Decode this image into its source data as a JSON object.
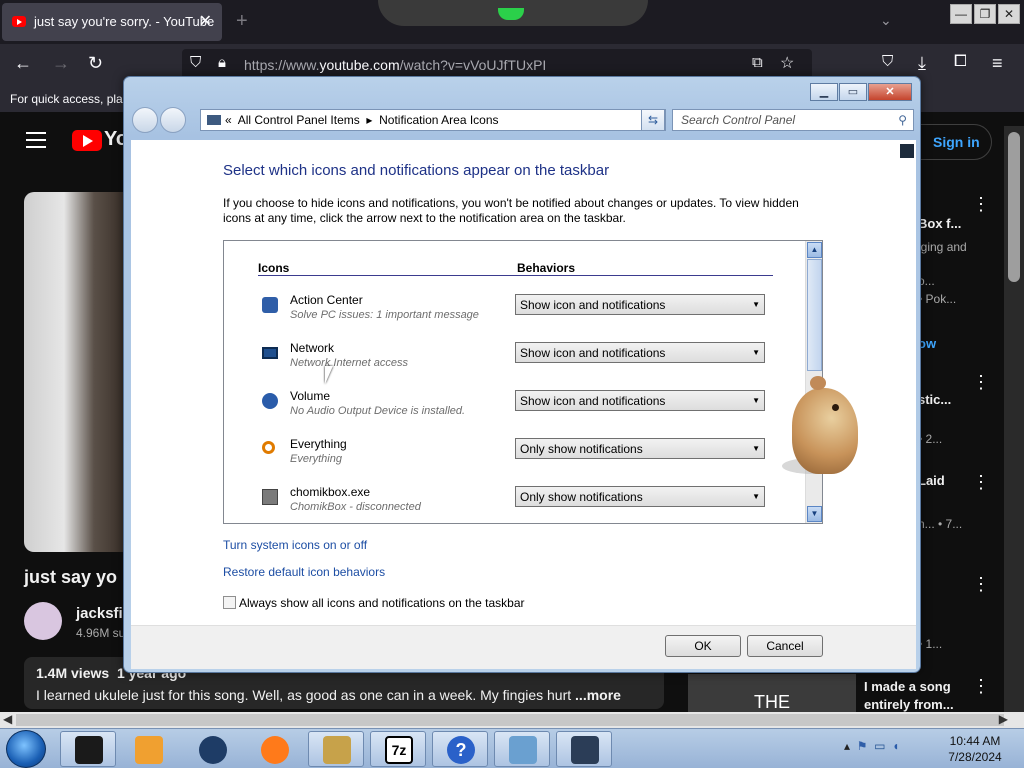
{
  "browser": {
    "tab_title": "just say you're sorry. - YouTube",
    "tab_close": "✕",
    "new_tab": "+",
    "url_prefix": "https://www.",
    "url_domain": "youtube.com",
    "url_rest": "/watch?v=vVoUJfTUxPI",
    "bookmarks_text": "For quick access, plac",
    "window_buttons": [
      "—",
      "❐",
      "✕"
    ]
  },
  "youtube": {
    "logo_text": "Yo",
    "sign_in": "Sign in",
    "video_title": "just say yo",
    "channel_name": "jacksfi",
    "channel_subs": "4.96M su",
    "views": "1.4M views",
    "age": "1 year ago",
    "description": "I learned ukulele just for this song. Well, as good as one can in a week. My fingies hurt",
    "more": "...more",
    "side": [
      {
        "title": "Box f...",
        "sub": "iging and"
      },
      {
        "title": "",
        "sub": "o..."
      },
      {
        "title": "",
        "sub": "• Pok..."
      },
      {
        "title": "ow",
        "sub": ""
      },
      {
        "title": "stic...",
        "sub": "• 2..."
      },
      {
        "title": "Laid",
        "sub": "n... • 7..."
      },
      {
        "title": "",
        "sub": "• 1..."
      }
    ],
    "bottom_thumb_text": "THE",
    "bottom_title_1": "I made a song",
    "bottom_title_2": "entirely from..."
  },
  "control_panel": {
    "breadcrumb_root": "All Control Panel Items",
    "breadcrumb_current": "Notification Area Icons",
    "search_placeholder": "Search Control Panel",
    "heading": "Select which icons and notifications appear on the taskbar",
    "intro": "If you choose to hide icons and notifications, you won't be notified about changes or updates. To view hidden icons at any time, click the arrow next to the notification area on the taskbar.",
    "col_icons": "Icons",
    "col_behaviors": "Behaviors",
    "rows": [
      {
        "name": "Action Center",
        "sub": "Solve PC issues: 1 important message",
        "behavior": "Show icon and notifications",
        "icon": "flag-icon",
        "color": "#2f5ea8"
      },
      {
        "name": "Network",
        "sub": "Network Internet access",
        "behavior": "Show icon and notifications",
        "icon": "network-icon",
        "color": "#1f4f8f"
      },
      {
        "name": "Volume",
        "sub": "No Audio Output Device is installed.",
        "behavior": "Show icon and notifications",
        "icon": "volume-icon",
        "color": "#2a5caa"
      },
      {
        "name": "Everything",
        "sub": "Everything",
        "behavior": "Only show notifications",
        "icon": "search-icon",
        "color": "#e07b00"
      },
      {
        "name": "chomikbox.exe",
        "sub": "ChomikBox - disconnected",
        "behavior": "Only show notifications",
        "icon": "app-icon",
        "color": "#7a7a7a"
      }
    ],
    "link_system_icons": "Turn system icons on or off",
    "link_restore": "Restore default icon behaviors",
    "always_show_label": "Always show all icons and notifications on the taskbar",
    "ok": "OK",
    "cancel": "Cancel"
  },
  "taskbar": {
    "time": "10:44 AM",
    "date": "7/28/2024",
    "apps": [
      {
        "name": "terminal-app",
        "color": "#1a1a1a"
      },
      {
        "name": "media-player-app",
        "color": "#f0a030"
      },
      {
        "name": "globe-app",
        "color": "#1e3c66"
      },
      {
        "name": "firefox-app",
        "color": "#ff7a1a"
      },
      {
        "name": "chomikbox-app",
        "color": "#c7a24a"
      },
      {
        "name": "7zip-app",
        "color": "#ffffff"
      },
      {
        "name": "help-app",
        "color": "#2a61c9"
      },
      {
        "name": "network-app",
        "color": "#6aa0d0"
      },
      {
        "name": "screen-app",
        "color": "#2b3d57"
      }
    ]
  }
}
